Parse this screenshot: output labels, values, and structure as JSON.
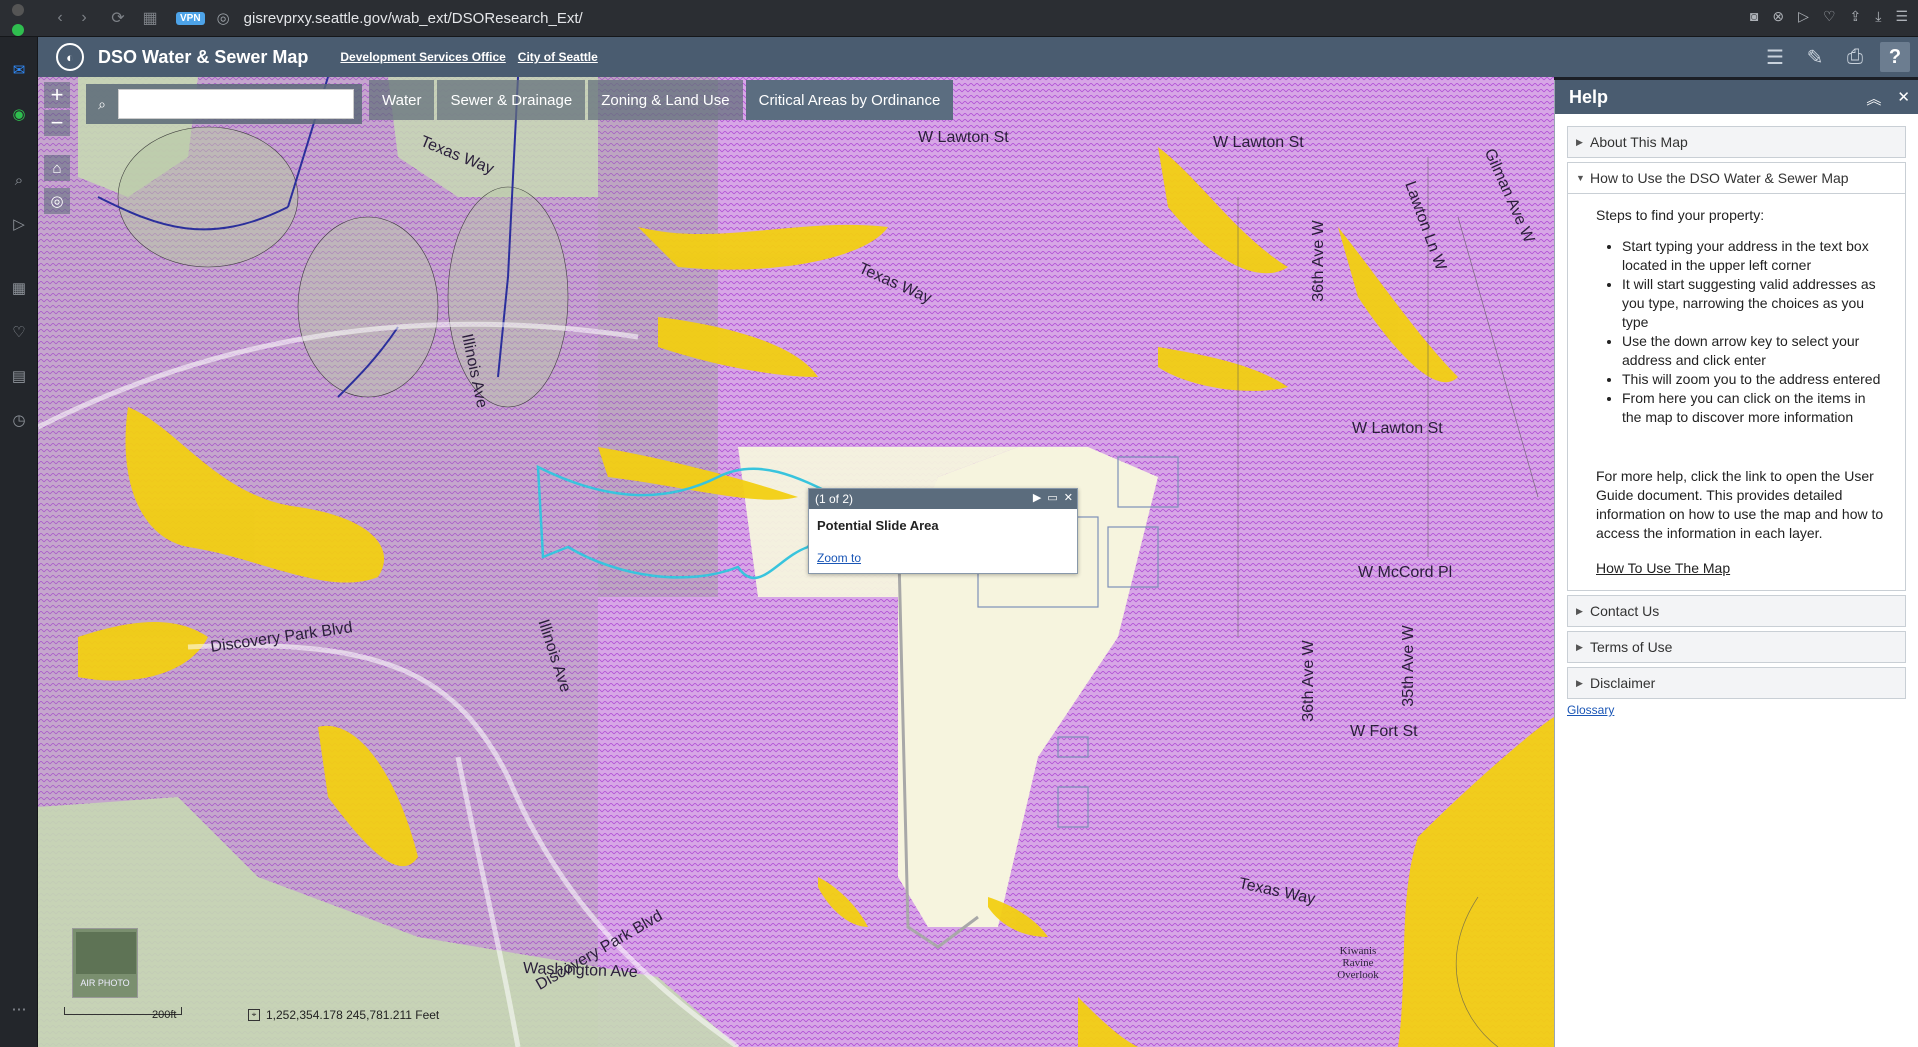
{
  "browser": {
    "url": "gisrevprxy.seattle.gov/wab_ext/DSOResearch_Ext/",
    "vpn": "VPN"
  },
  "app": {
    "title": "DSO Water & Sewer Map",
    "links": [
      "Development Services Office",
      "City of Seattle"
    ]
  },
  "search": {
    "placeholder": "",
    "value": ""
  },
  "tabs": [
    {
      "label": "Water"
    },
    {
      "label": "Sewer & Drainage"
    },
    {
      "label": "Zoning & Land Use"
    },
    {
      "label": "Critical Areas by Ordinance"
    }
  ],
  "map": {
    "streets": {
      "s1": "W Lawton St",
      "s2": "W Lawton St",
      "s3": "W Lawton St",
      "s4": "Texas Way",
      "s5": "Texas Way",
      "s6": "Texas Way",
      "s7": "Illinois Ave",
      "s8": "Illinois Ave",
      "s9": "Discovery Park Blvd",
      "s10": "Discovery Park Blvd",
      "s11": "Washington Ave",
      "s12": "36th Ave W",
      "s13": "36th Ave W",
      "s14": "35th Ave W",
      "s15": "W McCord Pl",
      "s16": "W Fort St",
      "s17": "Lawton Ln W",
      "s18": "Gilman Ave W",
      "s19": "Kiwanis Ravine Overlook"
    },
    "colors": {
      "slide": "#c97be0",
      "steep": "#f0d21a",
      "parks": "#c9d9b8",
      "urban": "#f6f4de"
    }
  },
  "popup": {
    "counter": "(1 of 2)",
    "title": "Potential Slide Area",
    "zoom": "Zoom to"
  },
  "overview": {
    "label": "AIR PHOTO"
  },
  "scale": {
    "label": "200ft"
  },
  "coords": {
    "text": "1,252,354.178  245,781.211 Feet"
  },
  "help": {
    "title": "Help",
    "sections": {
      "about": "About This Map",
      "howto": "How to Use the DSO Water & Sewer Map",
      "contact": "Contact Us",
      "terms": "Terms of Use",
      "disclaimer": "Disclaimer"
    },
    "intro": "Steps to find your property:",
    "steps": [
      "Start typing your address in the text box located in the upper left corner",
      "It will start suggesting valid addresses as you type, narrowing the choices as you type",
      "Use the down arrow key to select your address and click enter",
      "This will zoom you to the address entered",
      "From here you can click on the items in the map to discover more information"
    ],
    "more": "For more help, click the link to open the User Guide document. This provides detailed information on how to use the map and how to access the information in each layer.",
    "link": "How To Use The Map",
    "glossary": "Glossary"
  }
}
